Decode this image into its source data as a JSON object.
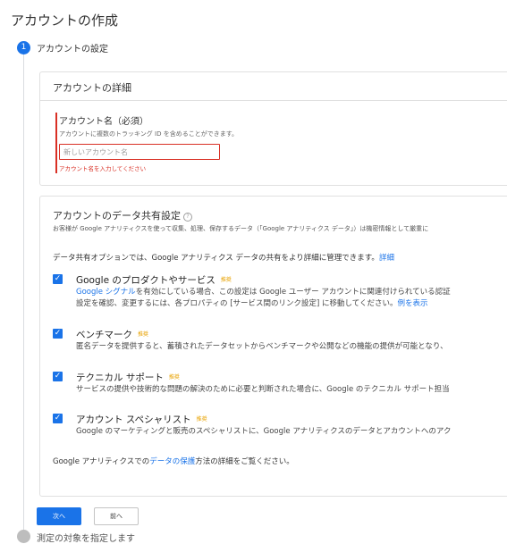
{
  "page": {
    "title": "アカウントの作成"
  },
  "stepper": {
    "step1_number": "1",
    "step1_label": "アカウントの設定",
    "step2_label": "測定の対象を指定します"
  },
  "details": {
    "title": "アカウントの詳細",
    "field_label": "アカウント名（必須）",
    "field_hint": "アカウントに複数のトラッキング ID を含めることができます。",
    "input_placeholder": "新しいアカウント名",
    "input_value": "",
    "error_text": "アカウント名を入力してください"
  },
  "sharing": {
    "title": "アカウントのデータ共有設定",
    "help_icon_glyph": "?",
    "description": "お客様が Google アナリティクスを使って収集、処理、保存するデータ（「Google アナリティクス データ」）は機密情報として厳重に",
    "intro_text": "データ共有オプションでは、Google アナリティクス データの共有をより詳細に管理できます。",
    "intro_link": "詳細",
    "options": [
      {
        "title": "Google のプロダクトやサービス",
        "badge": "推奨",
        "checked": true,
        "desc1_link": "Google シグナル",
        "desc1_rest": "を有効にしている場合、この設定は Google ユーザー アカウントに関連付けられている認証",
        "desc2_text": "設定を確認、変更するには、各プロパティの [サービス間のリンク設定] に移動してください。",
        "desc2_link": "例を表示"
      },
      {
        "title": "ベンチマーク",
        "badge": "推奨",
        "checked": true,
        "desc": "匿名データを提供すると、蓄積されたデータセットからベンチマークや公開などの機能の提供が可能となり、"
      },
      {
        "title": "テクニカル サポート",
        "badge": "推奨",
        "checked": true,
        "desc": "サービスの提供や技術的な問題の解決のために必要と判断された場合に、Google のテクニカル サポート担当"
      },
      {
        "title": "アカウント スペシャリスト",
        "badge": "推奨",
        "checked": true,
        "desc": "Google のマーケティングと販売のスペシャリストに、Google アナリティクスのデータとアカウントへのアク"
      }
    ],
    "footer_pre": "Google アナリティクスでの",
    "footer_link": "データの保護",
    "footer_post": "方法の詳細をご覧ください。"
  },
  "buttons": {
    "next": "次へ",
    "previous": "前へ"
  },
  "colors": {
    "accent": "#1a73e8",
    "error": "#d93025",
    "badge": "#e8a200"
  }
}
